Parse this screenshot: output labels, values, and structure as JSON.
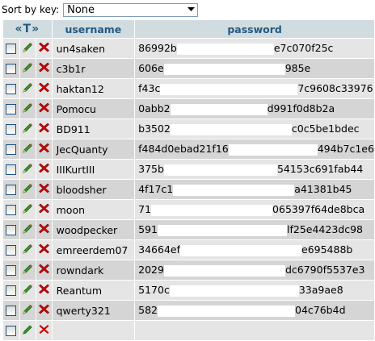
{
  "sort": {
    "label": "Sort by key:",
    "selected": "None"
  },
  "headers": {
    "sort_glyph": "«Т»",
    "username": "username",
    "password": "password"
  },
  "rows": [
    {
      "username": "un4saken",
      "pw_visible_start": "86992b",
      "pw_visible_end": "e7c070f25c"
    },
    {
      "username": "c3b1r",
      "pw_visible_start": "606e",
      "pw_visible_end": "985e"
    },
    {
      "username": "haktan12",
      "pw_visible_start": "f43c",
      "pw_visible_end": "7c9608c33976"
    },
    {
      "username": "Pomocu",
      "pw_visible_start": "0abb2",
      "pw_visible_end": "d991f0d8b2a"
    },
    {
      "username": "BD911",
      "pw_visible_start": "b3502",
      "pw_visible_end": "c0c5be1bdec"
    },
    {
      "username": "JecQuanty",
      "pw_visible_start": "f484d0ebad21f16",
      "pw_visible_end": "494b7c1e6"
    },
    {
      "username": "IIIKurtIII",
      "pw_visible_start": "375b",
      "pw_visible_end": "54153c691fab44"
    },
    {
      "username": "bloodsher",
      "pw_visible_start": "4f17c1",
      "pw_visible_end": "a41381b45"
    },
    {
      "username": "moon",
      "pw_visible_start": "71",
      "pw_visible_end": "065397f64de8bca"
    },
    {
      "username": "woodpecker",
      "pw_visible_start": "591",
      "pw_visible_end": "lf25e4423dc98"
    },
    {
      "username": "emreerdem07",
      "pw_visible_start": "34664ef",
      "pw_visible_end": "e695488b"
    },
    {
      "username": "rowndark",
      "pw_visible_start": "2029",
      "pw_visible_end": "dc6790f5537e3"
    },
    {
      "username": "Reantum",
      "pw_visible_start": "5170c",
      "pw_visible_end": "33a9ae8"
    },
    {
      "username": "qwerty321",
      "pw_visible_start": "582",
      "pw_visible_end": "04c76b4d"
    }
  ],
  "icons": {
    "edit": "pencil-icon",
    "delete": "delete-x-icon"
  },
  "colors": {
    "header_bg": "#d0dce0",
    "header_text": "#235a81",
    "row_odd": "#e5e5e5",
    "row_even": "#d5d5d5",
    "delete_red": "#cc0000",
    "pencil_green": "#2e8b2e"
  }
}
